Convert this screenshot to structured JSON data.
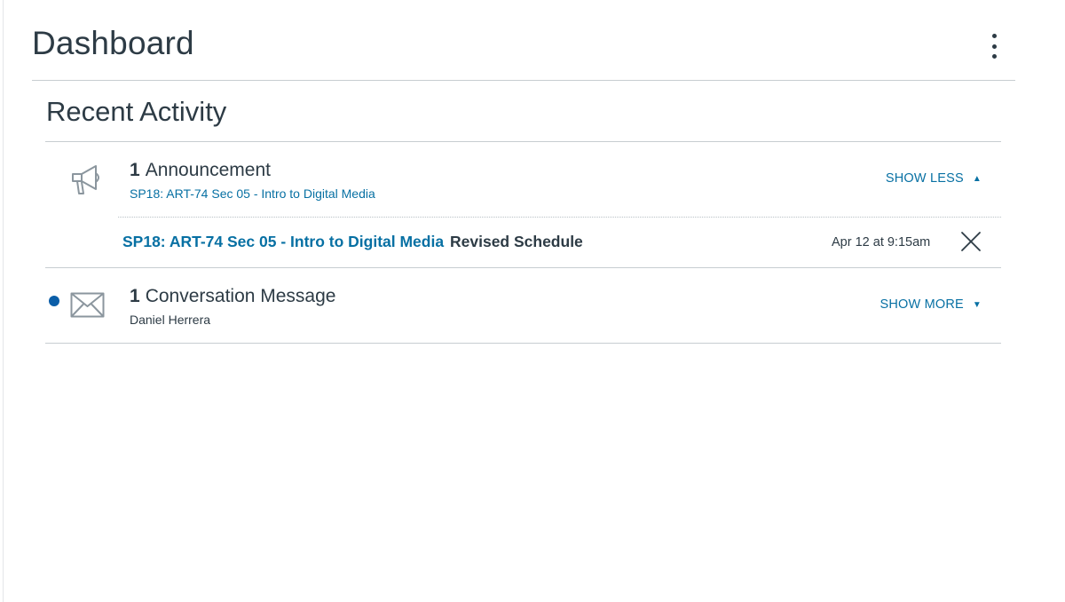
{
  "header": {
    "title": "Dashboard",
    "options_icon": "kebab-vertical-icon"
  },
  "recent_activity": {
    "title": "Recent Activity",
    "items": [
      {
        "icon": "megaphone-icon",
        "count": "1",
        "label": "Announcement",
        "subtitle": "SP18: ART-74 Sec 05 - Intro to Digital Media",
        "toggle_label": "SHOW LESS",
        "toggle_caret": "▲",
        "expanded": true,
        "details": [
          {
            "course": "SP18: ART-74 Sec 05 - Intro to Digital Media",
            "title": "Revised Schedule",
            "date": "Apr 12 at 9:15am"
          }
        ]
      },
      {
        "icon": "envelope-icon",
        "unread": true,
        "count": "1",
        "label": "Conversation Message",
        "subtitle": "Daniel Herrera",
        "toggle_label": "SHOW MORE",
        "toggle_caret": "▼",
        "expanded": false
      }
    ]
  },
  "colors": {
    "text": "#2d3b45",
    "link": "#0770a3",
    "unread_dot": "#0b5ea8",
    "divider": "#c7cdd1"
  }
}
